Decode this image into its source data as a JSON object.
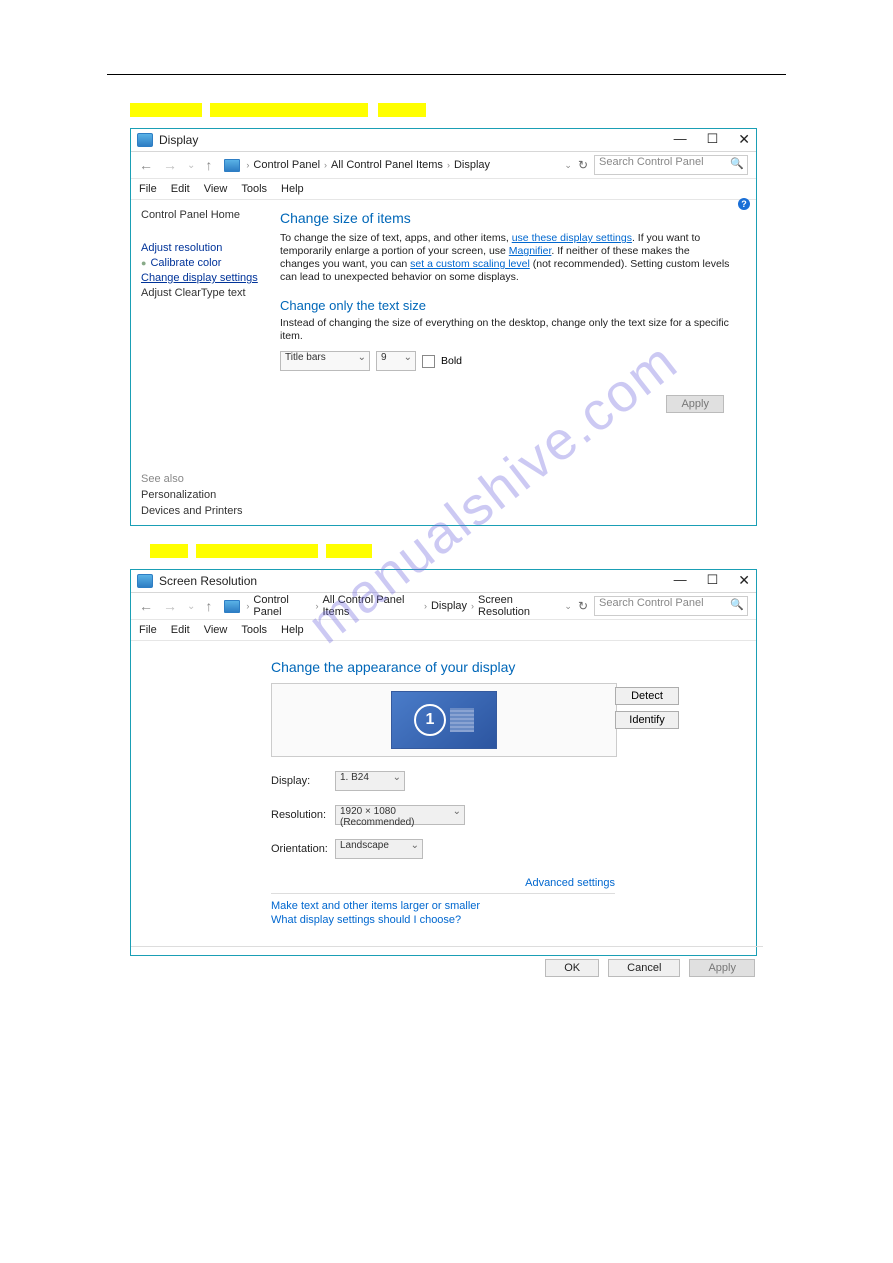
{
  "watermark": "manualshive.com",
  "win1": {
    "title": "Display",
    "breadcrumbs": [
      "Control Panel",
      "All Control Panel Items",
      "Display"
    ],
    "search_placeholder": "Search Control Panel",
    "menus": [
      "File",
      "Edit",
      "View",
      "Tools",
      "Help"
    ],
    "sidebar": {
      "home": "Control Panel Home",
      "items": [
        "Adjust resolution",
        "Calibrate color",
        "Change display settings",
        "Adjust ClearType text"
      ],
      "seealso_title": "See also",
      "seealso": [
        "Personalization",
        "Devices and Printers"
      ]
    },
    "content": {
      "h1": "Change size of items",
      "para_pre": "To change the size of text, apps, and other items, ",
      "link1": "use these display settings",
      "para_mid": ". If you want to temporarily enlarge a portion of your screen, use ",
      "link2": "Magnifier",
      "para_mid2": ". If neither of these makes the changes you want, you can ",
      "link3": "set a custom scaling level",
      "para_end": " (not recommended). Setting custom levels can lead to unexpected behavior on some displays.",
      "h2": "Change only the text size",
      "para2": "Instead of changing the size of everything on the desktop, change only the text size for a specific item.",
      "sel_item": "Title bars",
      "sel_size": "9",
      "bold": "Bold",
      "apply": "Apply"
    }
  },
  "win2": {
    "title": "Screen Resolution",
    "breadcrumbs": [
      "Control Panel",
      "All Control Panel Items",
      "Display",
      "Screen Resolution"
    ],
    "search_placeholder": "Search Control Panel",
    "menus": [
      "File",
      "Edit",
      "View",
      "Tools",
      "Help"
    ],
    "content": {
      "h1": "Change the appearance of your display",
      "monitor_num": "1",
      "detect": "Detect",
      "identify": "Identify",
      "labels": {
        "display": "Display:",
        "resolution": "Resolution:",
        "orientation": "Orientation:"
      },
      "values": {
        "display": "1. B24",
        "resolution": "1920 × 1080 (Recommended)",
        "orientation": "Landscape"
      },
      "advanced": "Advanced settings",
      "link1": "Make text and other items larger or smaller",
      "link2": "What display settings should I choose?",
      "ok": "OK",
      "cancel": "Cancel",
      "apply": "Apply"
    }
  }
}
